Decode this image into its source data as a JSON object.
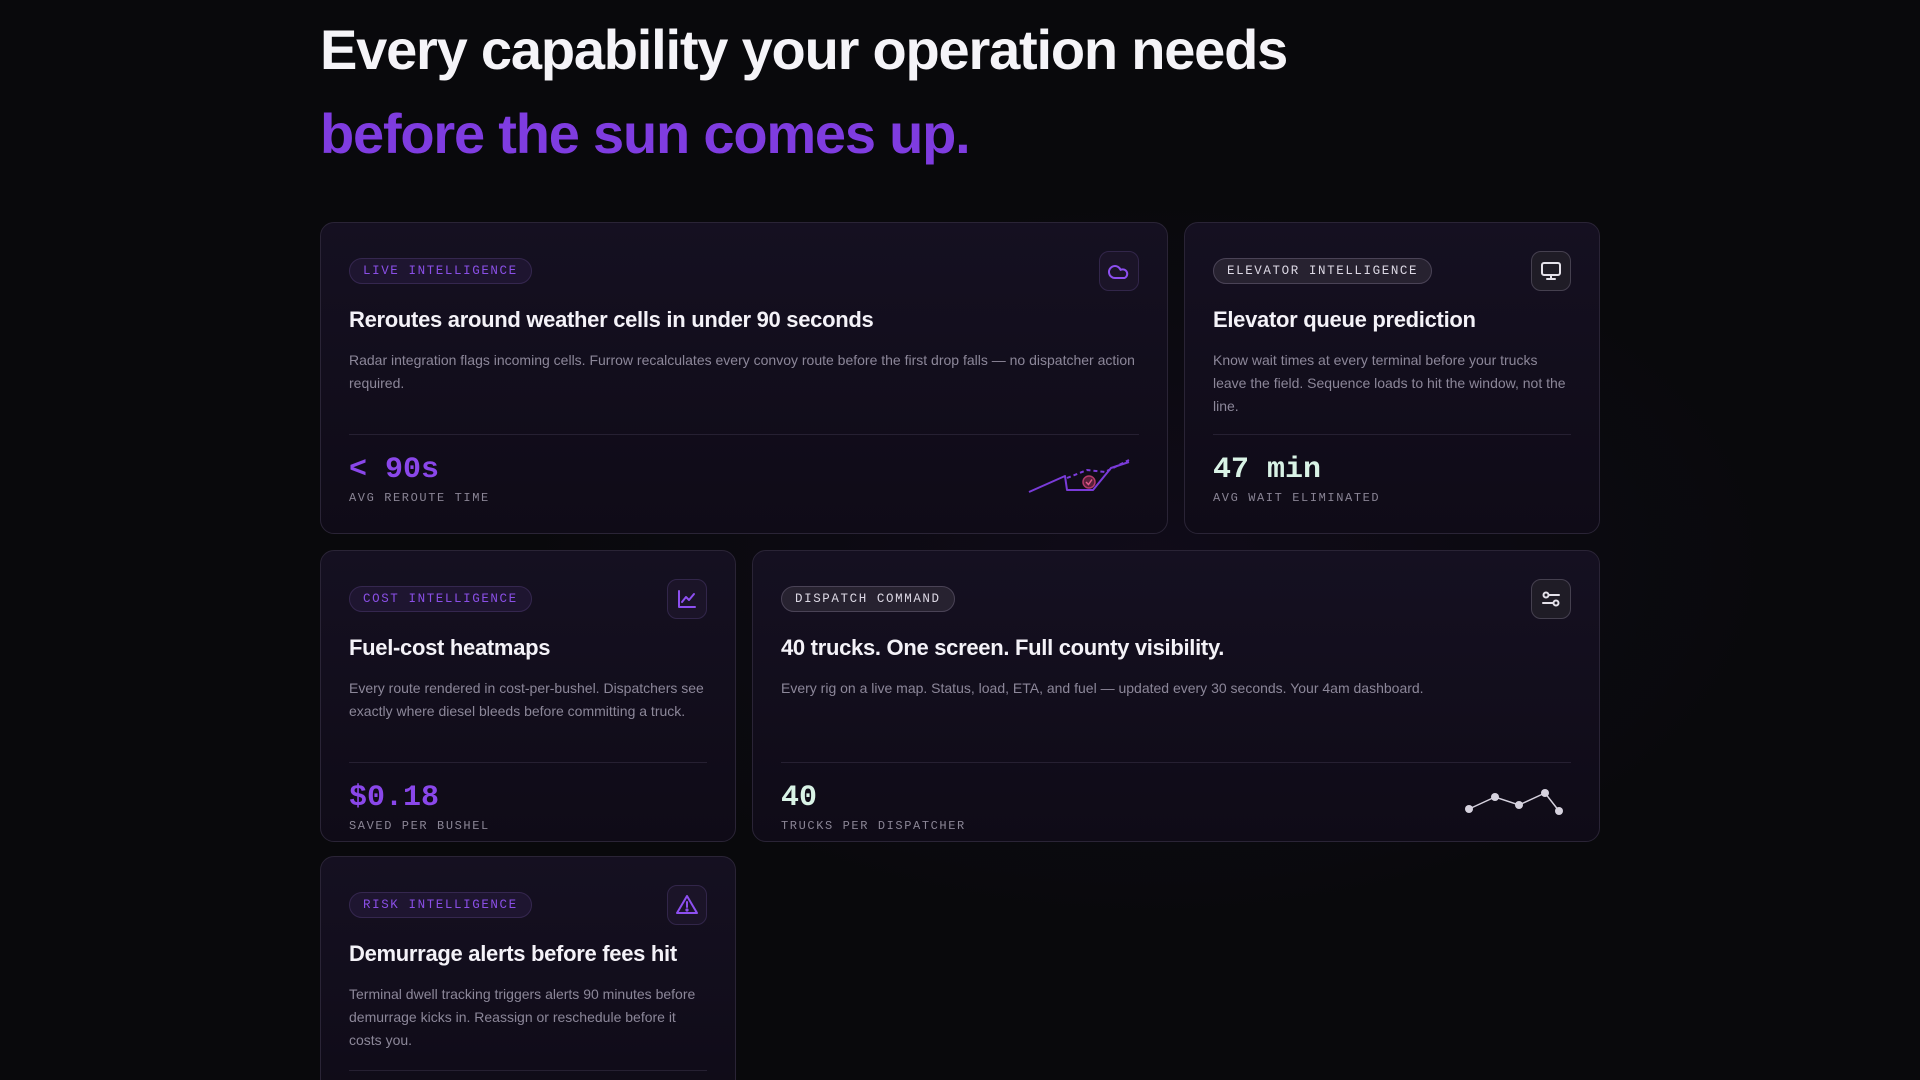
{
  "hero": {
    "headline": "Every capability your operation needs",
    "headline_accent": "before the sun comes up."
  },
  "colors": {
    "background": "#09090c",
    "accent_purple": "#7f3ce0",
    "metric_mint": "#d9f3e6",
    "card_border": "#2a2436"
  },
  "cards": [
    {
      "tag": "LIVE INTELLIGENCE",
      "icon": "cloud-icon",
      "title": "Reroutes around weather cells in under 90 seconds",
      "description": "Radar integration flags incoming cells. Furrow recalculates every convoy route before the first drop falls — no dispatcher action required.",
      "metric": "< 90s",
      "metric_label": "AVG REROUTE TIME",
      "visual": "reroute-sparkline"
    },
    {
      "tag": "ELEVATOR INTELLIGENCE",
      "icon": "monitor-icon",
      "title": "Elevator queue prediction",
      "description": "Know wait times at every terminal before your trucks leave the field. Sequence loads to hit the window, not the line.",
      "metric": "47 min",
      "metric_label": "AVG WAIT ELIMINATED"
    },
    {
      "tag": "COST INTELLIGENCE",
      "icon": "line-chart-icon",
      "title": "Fuel-cost heatmaps",
      "description": "Every route rendered in cost-per-bushel. Dispatchers see exactly where diesel bleeds before committing a truck.",
      "metric": "$0.18",
      "metric_label": "SAVED PER BUSHEL"
    },
    {
      "tag": "DISPATCH COMMAND",
      "icon": "sliders-icon",
      "title": "40 trucks. One screen. Full county visibility.",
      "description": "Every rig on a live map. Status, load, ETA, and fuel — updated every 30 seconds. Your 4am dashboard.",
      "metric": "40",
      "metric_label": "TRUCKS PER DISPATCHER",
      "visual": "network-nodes"
    },
    {
      "tag": "RISK INTELLIGENCE",
      "icon": "warning-triangle-icon",
      "title": "Demurrage alerts before fees hit",
      "description": "Terminal dwell tracking triggers alerts 90 minutes before demurrage kicks in. Reassign or reschedule before it costs you."
    }
  ]
}
